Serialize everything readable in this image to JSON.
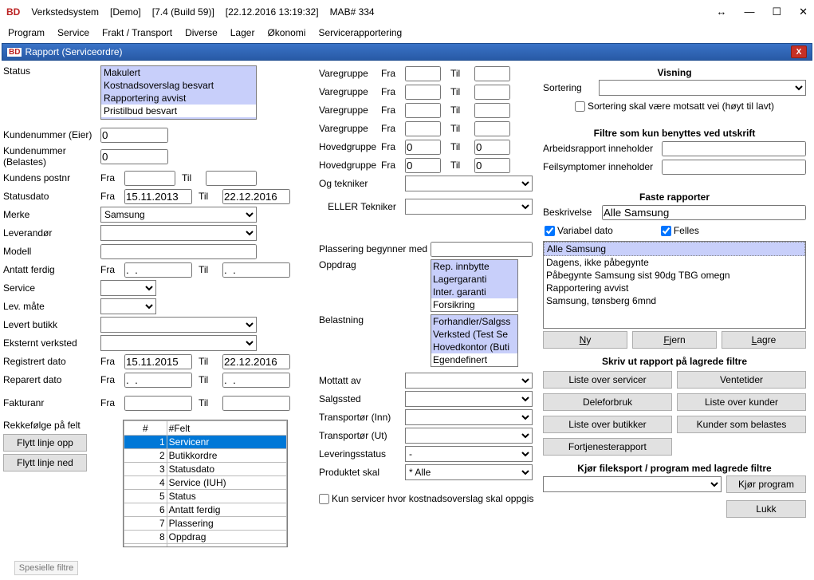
{
  "title": {
    "app": "Verkstedsystem",
    "env": "[Demo]",
    "ver": "[7.4 (Build 59)]",
    "ts": "[22.12.2016   13:19:32]",
    "mab": "MAB# 334"
  },
  "win": {
    "resizer": "↔",
    "min": "—",
    "max": "☐",
    "close": "✕"
  },
  "menu": [
    "Program",
    "Service",
    "Frakt / Transport",
    "Diverse",
    "Lager",
    "Økonomi",
    "Servicerapportering"
  ],
  "subwin": {
    "logo": "BD",
    "title": "Rapport (Serviceordre)",
    "close": "X"
  },
  "left": {
    "status_label": "Status",
    "status_items": [
      "Makulert",
      "Kostnadsoverslag besvart",
      "Rapportering avvist",
      "Pristilbud besvart"
    ],
    "kundenr_eier": {
      "label": "Kundenummer (Eier)",
      "val": "0"
    },
    "kundenr_bel": {
      "label": "Kundenummer (Belastes)",
      "val": "0"
    },
    "kundepostnr": {
      "label": "Kundens postnr",
      "fra": "Fra",
      "til": "Til",
      "v1": "",
      "v2": ""
    },
    "statusdato": {
      "label": "Statusdato",
      "fra": "Fra",
      "til": "Til",
      "v1": "15.11.2013",
      "v2": "22.12.2016"
    },
    "merke": {
      "label": "Merke",
      "val": "Samsung"
    },
    "lever": {
      "label": "Leverandør",
      "val": ""
    },
    "modell": {
      "label": "Modell",
      "val": ""
    },
    "antatt": {
      "label": "Antatt ferdig",
      "fra": "Fra",
      "til": "Til",
      "v1": ".  .",
      "v2": ".  ."
    },
    "service": {
      "label": "Service",
      "val": ""
    },
    "levmate": {
      "label": "Lev. måte",
      "val": ""
    },
    "levbutikk": {
      "label": "Levert butikk",
      "val": ""
    },
    "ekstverk": {
      "label": "Eksternt verksted",
      "val": ""
    },
    "regdato": {
      "label": "Registrert dato",
      "fra": "Fra",
      "til": "Til",
      "v1": "15.11.2015",
      "v2": "22.12.2016"
    },
    "repdato": {
      "label": "Reparert dato",
      "fra": "Fra",
      "til": "Til",
      "v1": ".  .",
      "v2": ".  ."
    },
    "fakturanr": {
      "label": "Fakturanr",
      "fra": "Fra",
      "til": "Til",
      "v1": "",
      "v2": ""
    },
    "rekkefolge_label": "Rekkefølge på felt",
    "btn_up": "Flytt linje opp",
    "btn_down": "Flytt linje ned",
    "table_h": "#Felt",
    "rows": [
      {
        "n": "1",
        "t": "Servicenr"
      },
      {
        "n": "2",
        "t": "Butikkordre"
      },
      {
        "n": "3",
        "t": "Statusdato"
      },
      {
        "n": "4",
        "t": "Service (IUH)"
      },
      {
        "n": "5",
        "t": "Status"
      },
      {
        "n": "6",
        "t": "Antatt ferdig"
      },
      {
        "n": "7",
        "t": "Plassering"
      },
      {
        "n": "8",
        "t": "Oppdrag"
      }
    ],
    "spesielle": "Spesielle filtre"
  },
  "mid": {
    "vg": {
      "label": "Varegruppe",
      "fra": "Fra",
      "til": "Til"
    },
    "hg": {
      "label": "Hovedgruppe",
      "fra": "Fra",
      "til": "Til",
      "v": "0"
    },
    "ogtek": {
      "label": "Og tekniker"
    },
    "ellertek": {
      "label": "ELLER Tekniker"
    },
    "plass": {
      "label": "Plassering begynner med"
    },
    "oppdrag": {
      "label": "Oppdrag",
      "items": [
        "Rep. innbytte",
        "Lagergaranti",
        "Inter. garanti",
        "Forsikring"
      ]
    },
    "belast": {
      "label": "Belastning",
      "items": [
        "Forhandler/Salgss",
        "Verksted (Test Se",
        "Hovedkontor (Buti",
        "Egendefinert"
      ]
    },
    "mottatt": "Mottatt av",
    "salgssted": "Salgssted",
    "trinn": "Transportør (Inn)",
    "trut": "Transportør (Ut)",
    "levstatus": {
      "label": "Leveringsstatus",
      "val": "-"
    },
    "prodskal": {
      "label": "Produktet skal",
      "val": "* Alle"
    },
    "kunserv": "Kun servicer hvor kostnadsoverslag skal oppgis"
  },
  "right": {
    "visning": "Visning",
    "sortering": "Sortering",
    "sortrev": "Sortering skal være motsatt vei (høyt til lavt)",
    "filtre_title": "Filtre som kun benyttes ved utskrift",
    "arbeids": "Arbeidsrapport inneholder",
    "feilsymp": "Feilsymptomer inneholder",
    "faste": "Faste rapporter",
    "beskriv": "Beskrivelse",
    "beskriv_val": "Alle Samsung",
    "vdato": "Variabel dato",
    "felles": "Felles",
    "rep_items": [
      "Alle Samsung",
      "Dagens, ikke påbegynte",
      "Påbegynte Samsung sist 90dg TBG omegn",
      "Rapportering avvist",
      "Samsung, tønsberg 6mnd"
    ],
    "ny": "Ny",
    "fjern": "Fjern",
    "lagre": "Lagre",
    "skriv_title": "Skriv ut rapport på lagrede filtre",
    "b1": "Liste over servicer",
    "b2": "Ventetider",
    "b3": "Deleforbruk",
    "b4": "Liste over kunder",
    "b5": "Liste over butikker",
    "b6": "Kunder som belastes",
    "b7": "Fortjenesterapport",
    "eksport_title": "Kjør fileksport / program med lagrede filtre",
    "kjor": "Kjør program",
    "lukk": "Lukk"
  }
}
